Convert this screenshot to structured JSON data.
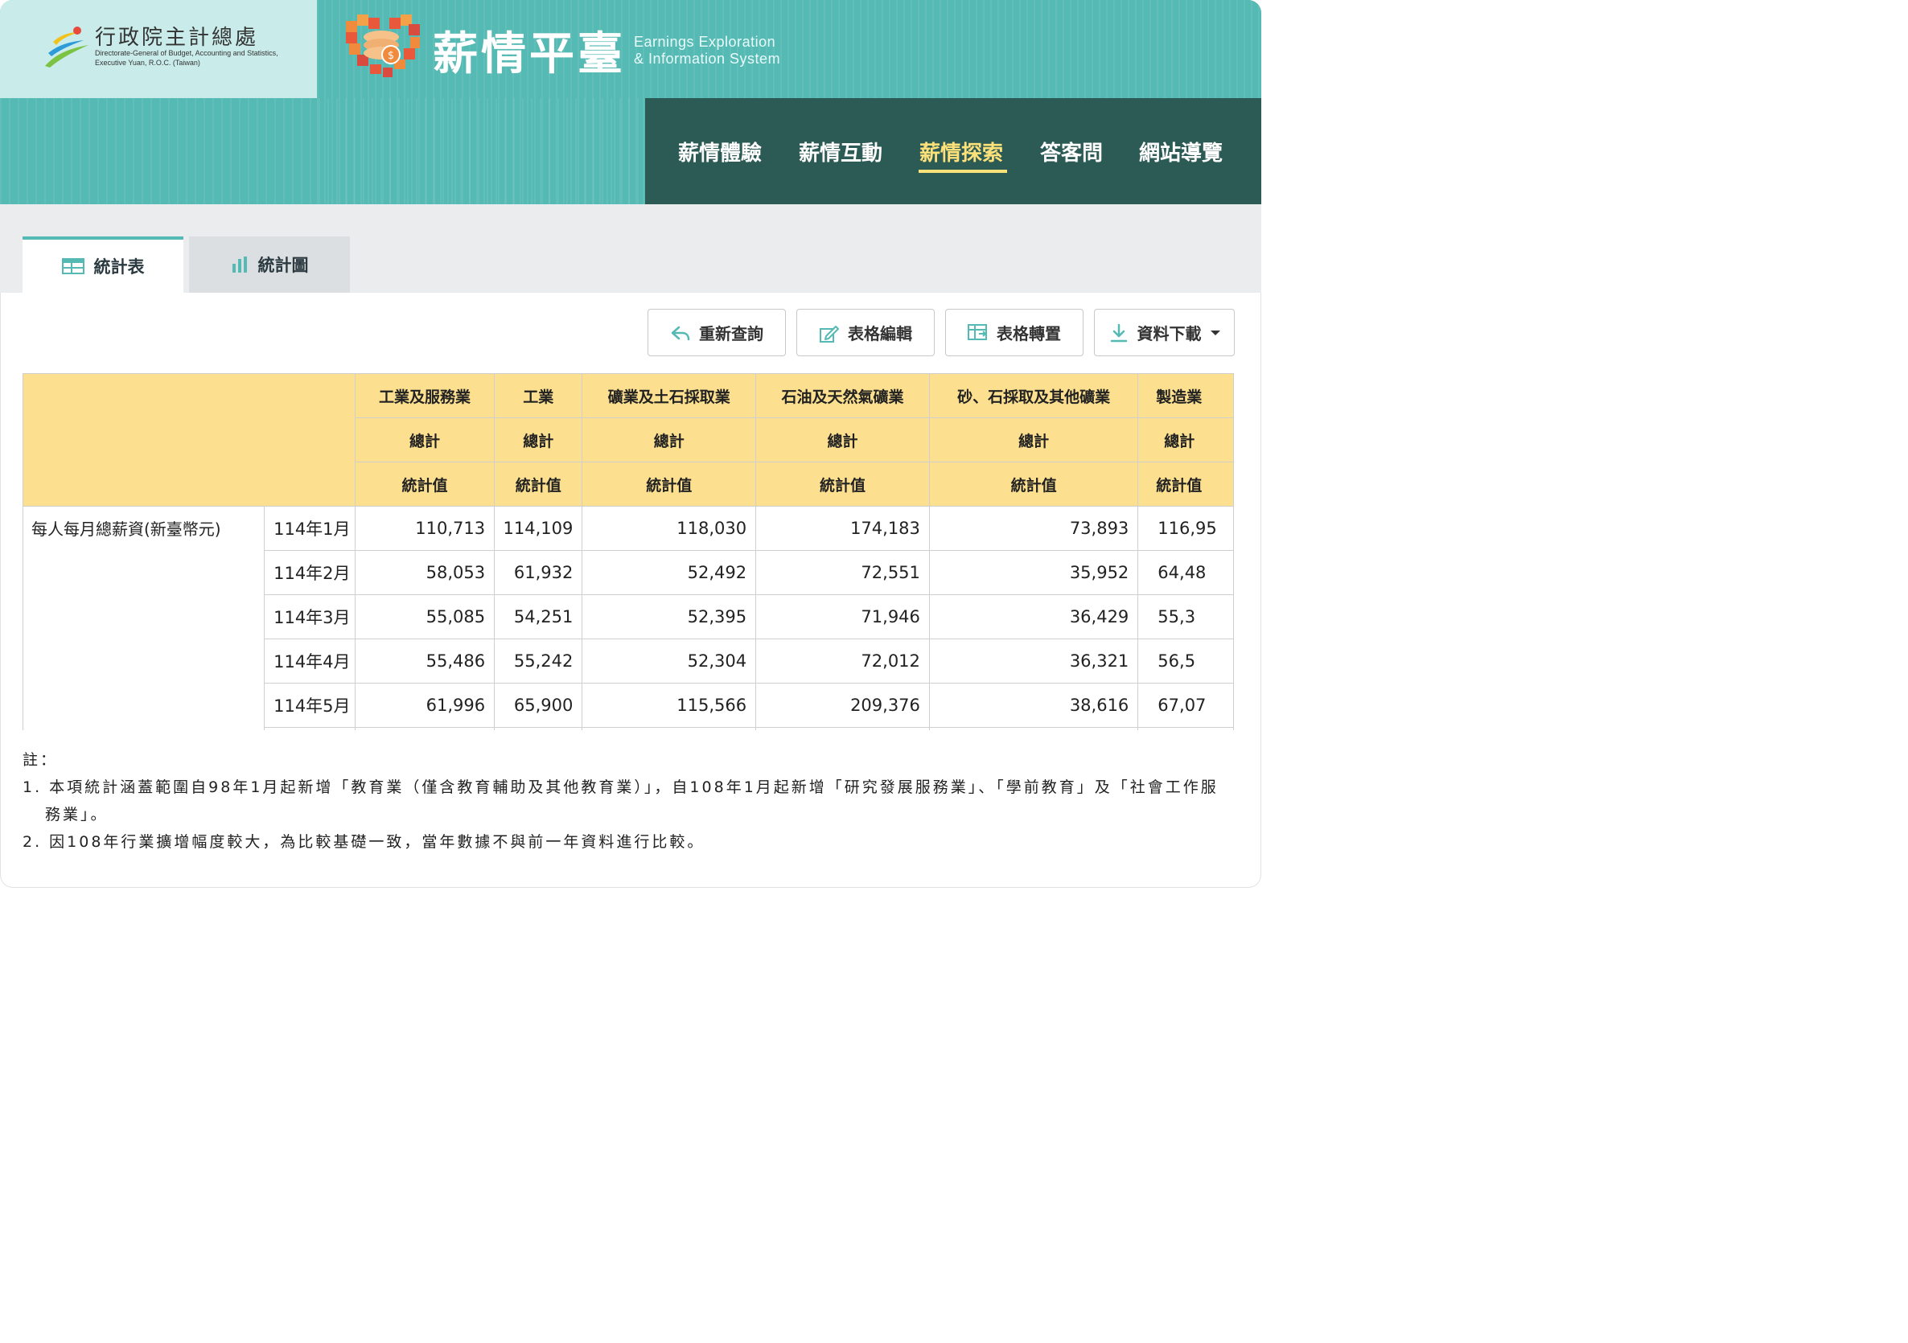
{
  "header": {
    "org_name": "行政院主計總處",
    "org_sub": "Directorate-General of Budget, Accounting and Statistics, Executive Yuan, R.O.C. (Taiwan)",
    "site_title": "薪情平臺",
    "site_en_line1": "Earnings Exploration",
    "site_en_line2": "& Information System",
    "colors": {
      "teal": "#55b9b4",
      "dark_nav": "#2c5b55",
      "active": "#ffe17a"
    }
  },
  "nav": {
    "items": [
      {
        "label": "薪情體驗"
      },
      {
        "label": "薪情互動"
      },
      {
        "label": "薪情探索"
      },
      {
        "label": "答客問"
      },
      {
        "label": "網站導覽"
      }
    ],
    "active": "薪情探索"
  },
  "tabs": [
    {
      "label": "統計表",
      "icon": "table-icon"
    },
    {
      "label": "統計圖",
      "icon": "bar-chart-icon"
    }
  ],
  "toolbar": {
    "requery": "重新查詢",
    "edit": "表格編輯",
    "transpose": "表格轉置",
    "download": "資料下載"
  },
  "table": {
    "columns": [
      {
        "industry": "工業及服務業",
        "sub": "總計",
        "stat": "統計值"
      },
      {
        "industry": "工業",
        "sub": "總計",
        "stat": "統計值"
      },
      {
        "industry": "礦業及土石採取業",
        "sub": "總計",
        "stat": "統計值"
      },
      {
        "industry": "石油及天然氣礦業",
        "sub": "總計",
        "stat": "統計值"
      },
      {
        "industry": "砂、石採取及其他礦業",
        "sub": "總計",
        "stat": "統計值"
      },
      {
        "industry": "製造業",
        "sub": "總計",
        "stat": "統計值"
      }
    ],
    "row_header": "每人每月總薪資(新臺幣元)",
    "rows": [
      {
        "period": "114年1月",
        "values": [
          "110,713",
          "114,109",
          "118,030",
          "174,183",
          "73,893",
          "116,95"
        ]
      },
      {
        "period": "114年2月",
        "values": [
          "58,053",
          "61,932",
          "52,492",
          "72,551",
          "35,952",
          "64,48"
        ]
      },
      {
        "period": "114年3月",
        "values": [
          "55,085",
          "54,251",
          "52,395",
          "71,946",
          "36,429",
          "55,3"
        ]
      },
      {
        "period": "114年4月",
        "values": [
          "55,486",
          "55,242",
          "52,304",
          "72,012",
          "36,321",
          "56,5"
        ]
      },
      {
        "period": "114年5月",
        "values": [
          "61,996",
          "65,900",
          "115,566",
          "209,376",
          "38,616",
          "67,07"
        ]
      }
    ]
  },
  "notes": {
    "title": "註：",
    "items": [
      "1. 本項統計涵蓋範圍自98年1月起新增「教育業（僅含教育輔助及其他教育業）」，自108年1月起新增「研究發展服務業」、「學前教育」及「社會工作服務業」。",
      "2. 因108年行業擴增幅度較大，為比較基礎一致，當年數據不與前一年資料進行比較。"
    ]
  }
}
